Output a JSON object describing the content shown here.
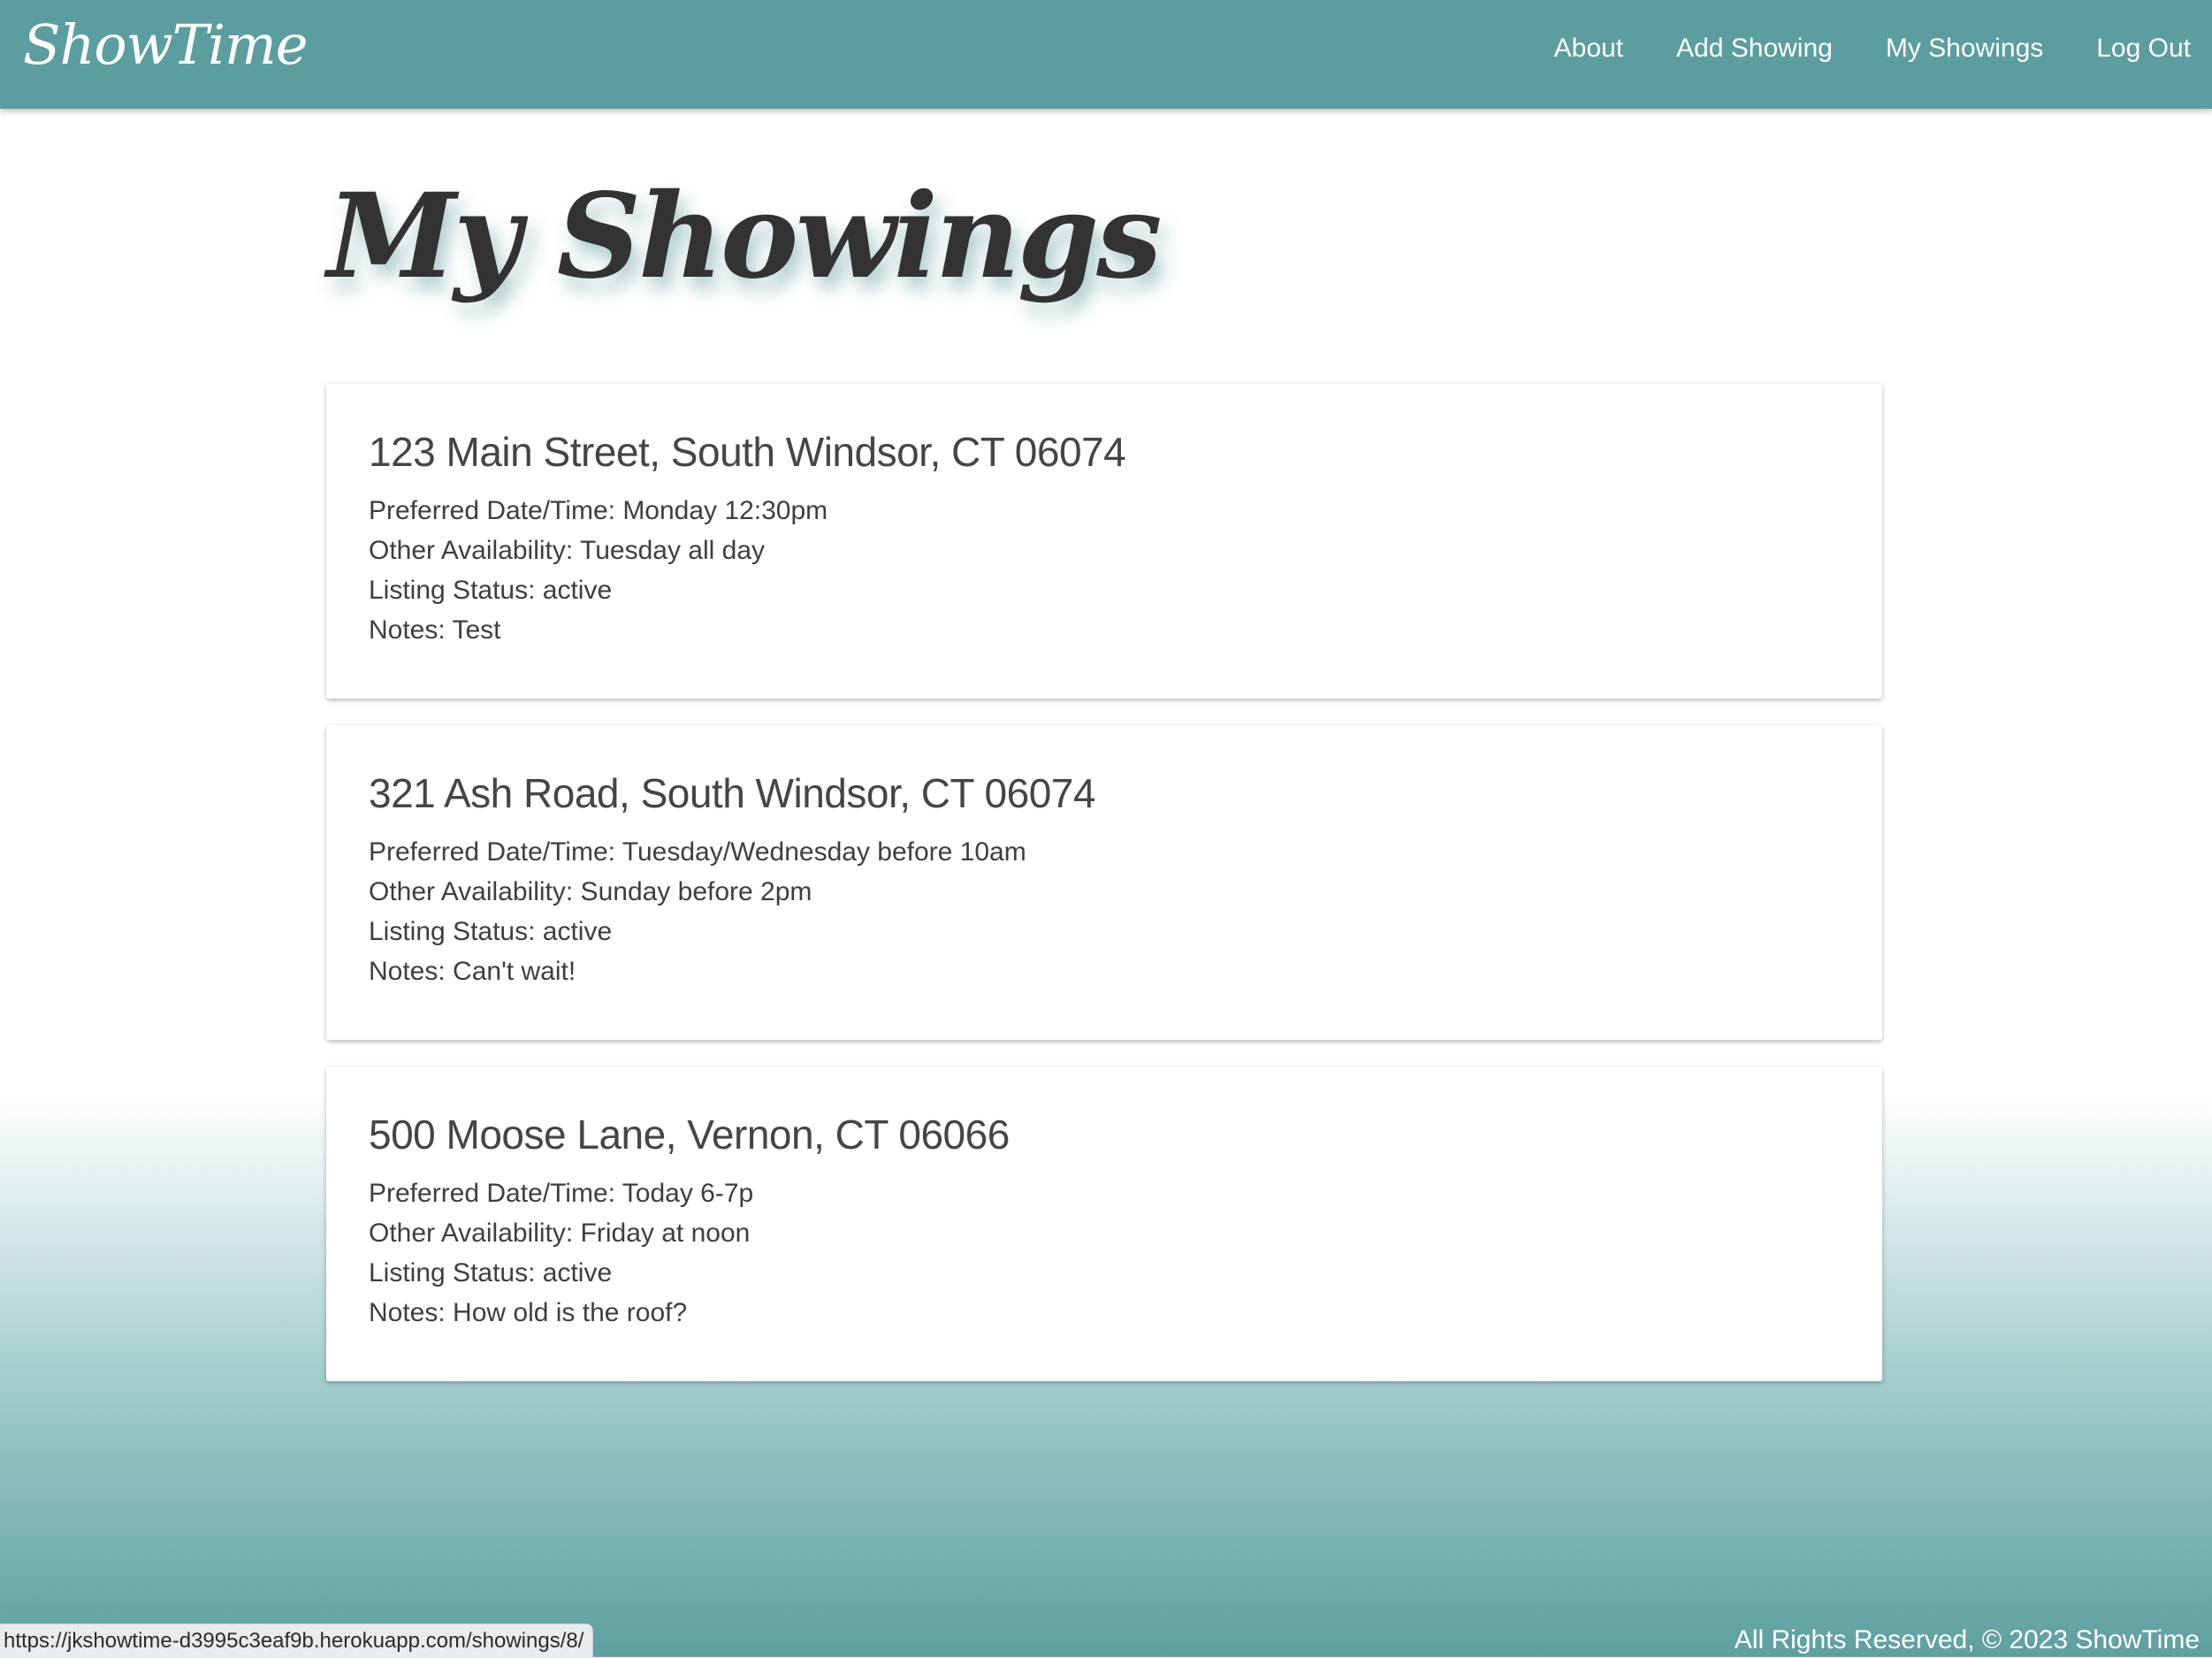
{
  "navbar": {
    "brand": "ShowTime",
    "links": [
      {
        "label": "About"
      },
      {
        "label": "Add Showing"
      },
      {
        "label": "My Showings"
      },
      {
        "label": "Log Out"
      }
    ]
  },
  "page": {
    "title": "My Showings"
  },
  "showings": [
    {
      "address": "123 Main Street, South Windsor, CT 06074",
      "preferred": "Preferred Date/Time: Monday 12:30pm",
      "other": "Other Availability: Tuesday all day",
      "status": "Listing Status: active",
      "notes": "Notes: Test"
    },
    {
      "address": "321 Ash Road, South Windsor, CT 06074",
      "preferred": "Preferred Date/Time: Tuesday/Wednesday before 10am",
      "other": "Other Availability: Sunday before 2pm",
      "status": "Listing Status: active",
      "notes": "Notes: Can't wait!"
    },
    {
      "address": "500 Moose Lane, Vernon, CT 06066",
      "preferred": "Preferred Date/Time: Today 6-7p",
      "other": "Other Availability: Friday at noon",
      "status": "Listing Status: active",
      "notes": "Notes: How old is the roof?"
    }
  ],
  "status_bar": {
    "url": "https://jkshowtime-d3995c3eaf9b.herokuapp.com/showings/8/"
  },
  "footer": {
    "text": "All Rights Reserved, © 2023 ShowTime"
  },
  "colors": {
    "navbar": "#5c9ea0",
    "title_text": "#333333"
  }
}
